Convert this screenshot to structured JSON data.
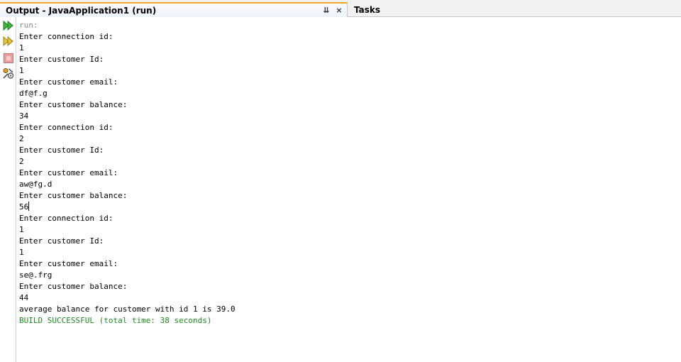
{
  "tabs": {
    "output_label": "Output - JavaApplication1 (run)",
    "tasks_label": "Tasks",
    "dropdown_glyph": "⇊",
    "close_glyph": "×"
  },
  "toolbar": {
    "buttons": [
      {
        "name": "rerun-icon",
        "color": "#2e9c2e"
      },
      {
        "name": "rerun-with-options-icon",
        "color": "#c7a21a"
      },
      {
        "name": "stop-icon",
        "color": "#e08080"
      },
      {
        "name": "output-settings-icon",
        "color": "#7a5a3a"
      }
    ]
  },
  "console": {
    "run_line": "run:",
    "lines": [
      "Enter connection id:",
      "1",
      "Enter customer Id:",
      "1",
      "Enter customer email:",
      "df@f.g",
      "Enter customer balance:",
      "34",
      "Enter connection id:",
      "2",
      "Enter customer Id:",
      "2",
      "Enter customer email:",
      "aw@fg.d",
      "Enter customer balance:",
      "56",
      "Enter connection id:",
      "1",
      "Enter customer Id:",
      "1",
      "Enter customer email:",
      "se@.frg",
      "Enter customer balance:",
      "44",
      "average balance for customer with id 1 is 39.0"
    ],
    "build_line": "BUILD SUCCESSFUL (total time: 38 seconds)"
  }
}
